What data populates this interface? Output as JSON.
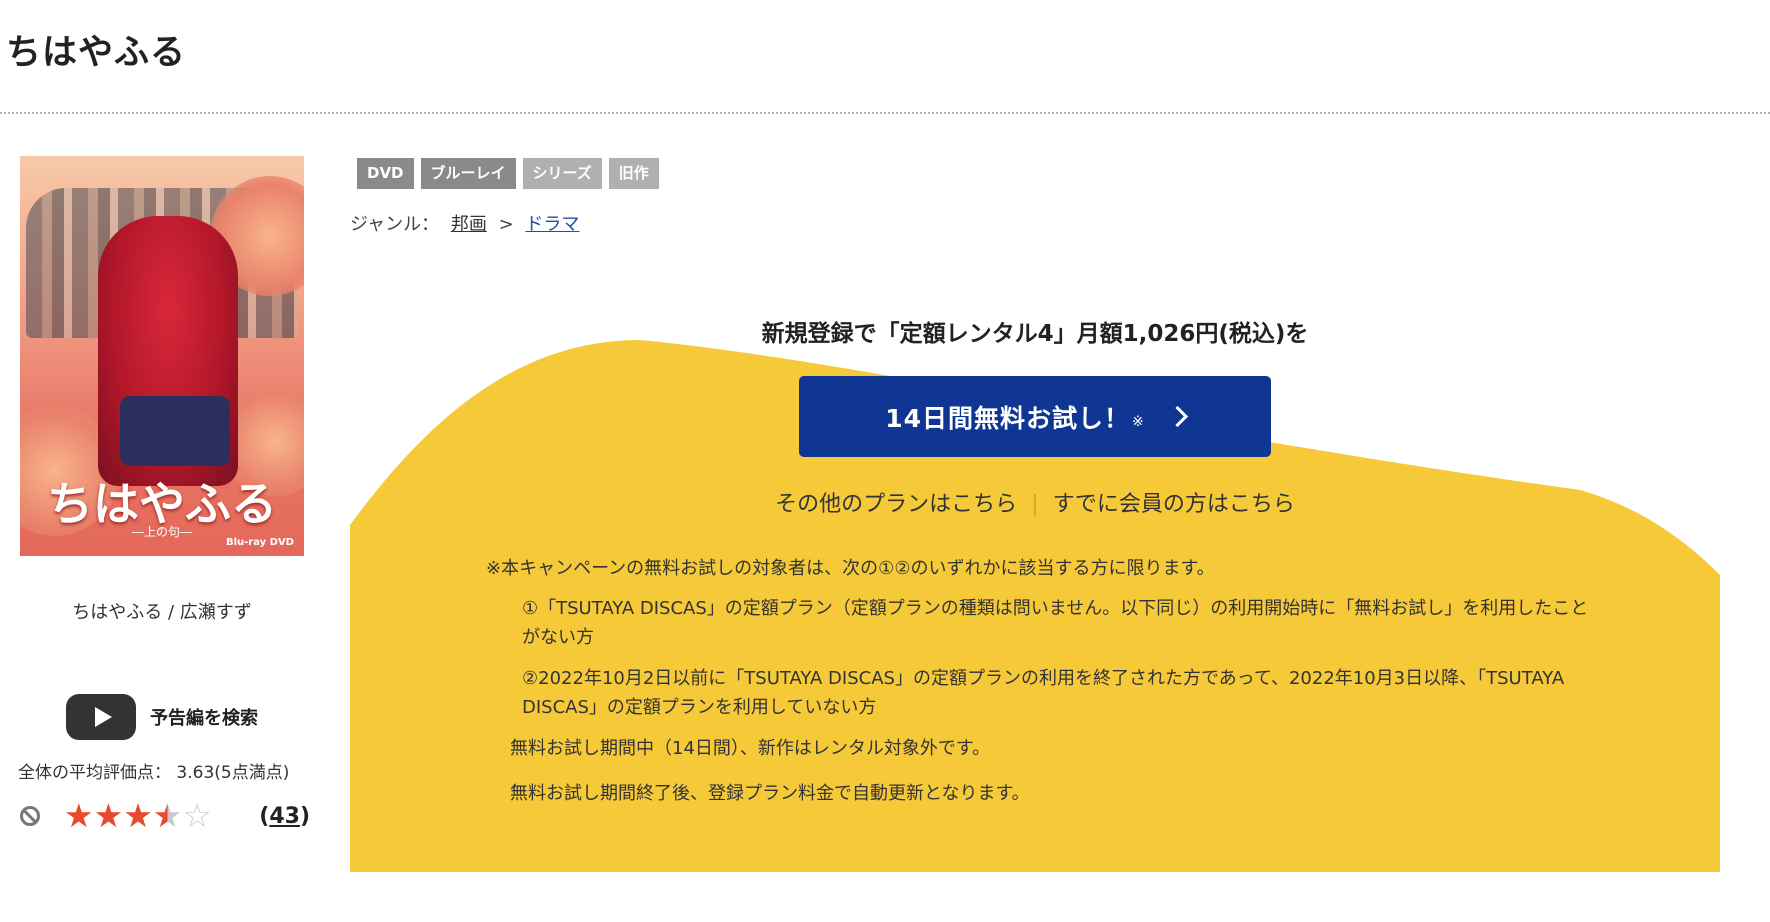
{
  "title": "ちはやふる",
  "cover": {
    "alt": "ちはやふる カバー",
    "logo_text": "ちはやふる",
    "sub_text": "―上の句―",
    "brand_text": "Blu-ray DVD"
  },
  "product_caption": "ちはやふる / 広瀬すず",
  "trailer": {
    "icon": "youtube-play-icon",
    "label": "予告編を検索"
  },
  "rating": {
    "average_text": "全体の平均評価点：  3.63(5点満点)",
    "average": 3.63,
    "max": 5,
    "stars_shown": 3.5,
    "review_count": "43",
    "open_paren": "(",
    "close_paren": ")"
  },
  "badges": [
    "DVD",
    "ブルーレイ",
    "シリーズ",
    "旧作"
  ],
  "genre": {
    "label": "ジャンル：",
    "items": [
      "邦画",
      "ドラマ"
    ],
    "separator": ">"
  },
  "campaign": {
    "headline": "新規登録で「定額レンタル4」月額1,026円(税込)を",
    "button_label": "14日間無料お試し！",
    "button_mark": "※",
    "other_plans_link": "その他のプランはこちら",
    "link_separator": "|",
    "member_link": "すでに会員の方はこちら",
    "notes": {
      "head": "※本キャンペーンの無料お試しの対象者は、次の①②のいずれかに該当する方に限ります。",
      "item1": "①「TSUTAYA DISCAS」の定額プラン（定額プランの種類は問いません。以下同じ）の利用開始時に「無料お試し」を利用したことがない方",
      "item2": "②2022年10月2日以前に「TSUTAYA DISCAS」の定額プランの利用を終了された方であって、2022年10月3日以降、「TSUTAYA DISCAS」の定額プランを利用していない方",
      "line3": "無料お試し期間中（14日間）、新作はレンタル対象外です。",
      "line4": "無料お試し期間終了後、登録プラン料金で自動更新となります。"
    },
    "colors": {
      "panel": "#f6c939",
      "button": "#0f3692"
    }
  }
}
